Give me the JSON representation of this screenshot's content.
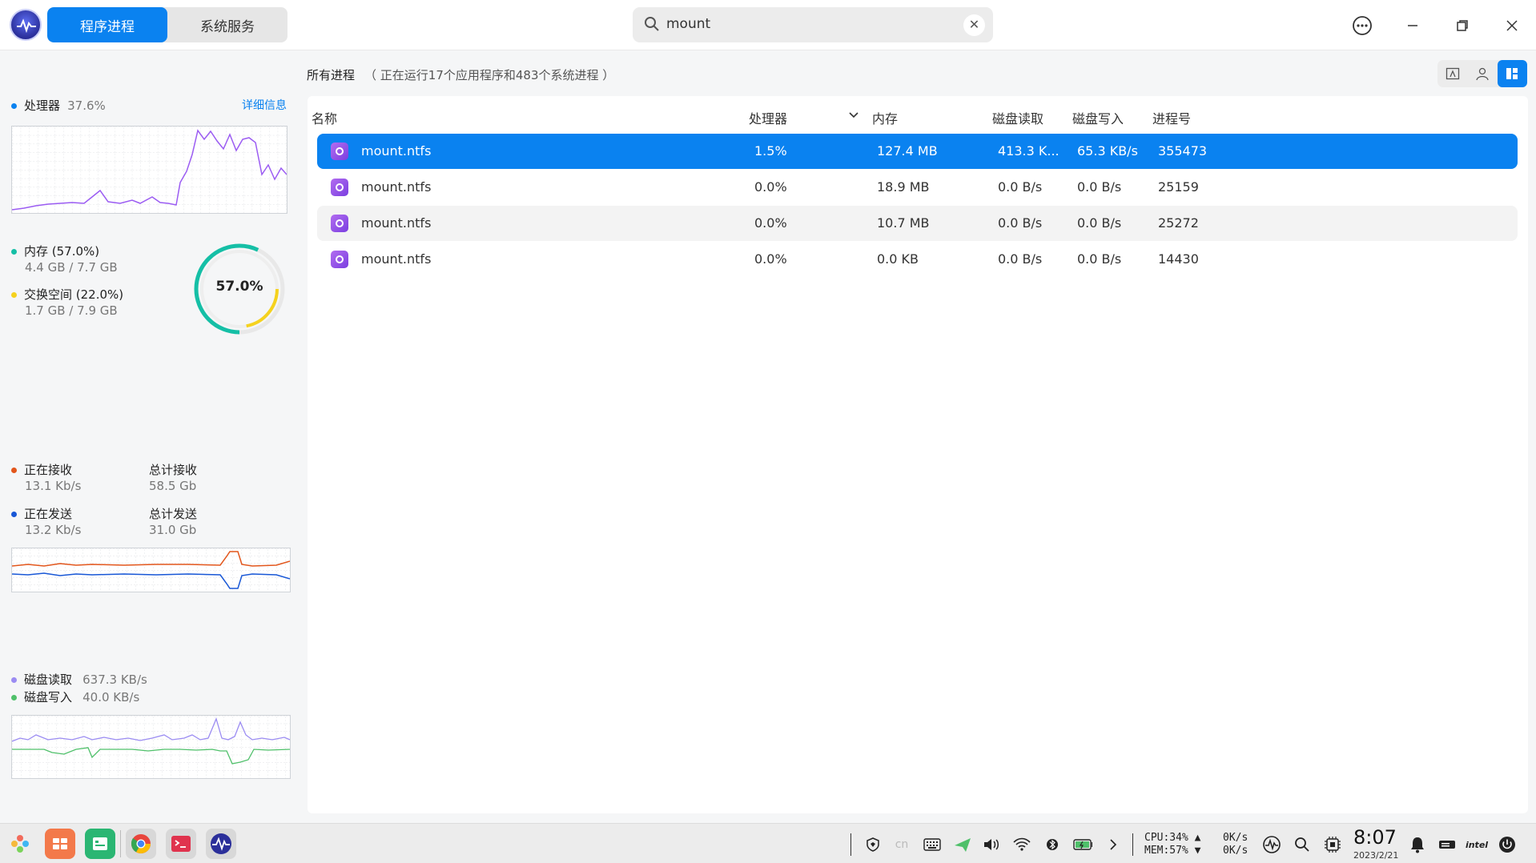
{
  "window": {
    "tabs": [
      "程序进程",
      "系统服务"
    ],
    "active_tab": 0,
    "search_value": "mount"
  },
  "sidebar": {
    "cpu": {
      "label": "处理器",
      "value": "37.6%",
      "detail_link": "详细信息"
    },
    "memory": {
      "label": "内存 (57.0%)",
      "usage": "4.4 GB / 7.7 GB",
      "swap_label": "交换空间 (22.0%)",
      "swap_usage": "1.7 GB / 7.9 GB",
      "ring_percent": "57.0%",
      "mem_fraction": 0.57,
      "swap_fraction": 0.22
    },
    "network": {
      "receiving_label": "正在接收",
      "receiving_value": "13.1 Kb/s",
      "total_received_label": "总计接收",
      "total_received_value": "58.5 Gb",
      "sending_label": "正在发送",
      "sending_value": "13.2 Kb/s",
      "total_sent_label": "总计发送",
      "total_sent_value": "31.0 Gb"
    },
    "disk": {
      "read_label": "磁盘读取",
      "read_value": "637.3 KB/s",
      "write_label": "磁盘写入",
      "write_value": "40.0 KB/s"
    }
  },
  "colors": {
    "accent": "#0a82f0",
    "cpu": "#9b5cf2",
    "memory": "#15bfa6",
    "swap": "#f5d21e",
    "net_receive": "#e2561c",
    "net_send": "#1857d6",
    "disk_read": "#9b8cf2",
    "disk_write": "#4fc06a"
  },
  "main": {
    "title": "所有进程",
    "summary": "（ 正在运行17个应用程序和483个系统进程 ）",
    "columns": [
      "名称",
      "处理器",
      "内存",
      "磁盘读取",
      "磁盘写入",
      "进程号"
    ],
    "processes": [
      {
        "name": "mount.ntfs",
        "cpu": "1.5%",
        "memory": "127.4 MB",
        "disk_read": "413.3 K...",
        "disk_write": "65.3 KB/s",
        "pid": "355473"
      },
      {
        "name": "mount.ntfs",
        "cpu": "0.0%",
        "memory": "18.9 MB",
        "disk_read": "0.0 B/s",
        "disk_write": "0.0 B/s",
        "pid": "25159"
      },
      {
        "name": "mount.ntfs",
        "cpu": "0.0%",
        "memory": "10.7 MB",
        "disk_read": "0.0 B/s",
        "disk_write": "0.0 B/s",
        "pid": "25272"
      },
      {
        "name": "mount.ntfs",
        "cpu": "0.0%",
        "memory": "0.0 KB",
        "disk_read": "0.0 B/s",
        "disk_write": "0.0 B/s",
        "pid": "14430"
      }
    ]
  },
  "taskbar": {
    "ime": "cn",
    "cpu_text": "CPU:34%",
    "mem_text": "MEM:57%",
    "net_up": "0K/s",
    "net_down": "0K/s",
    "time": "8:07",
    "date": "2023/2/21"
  }
}
